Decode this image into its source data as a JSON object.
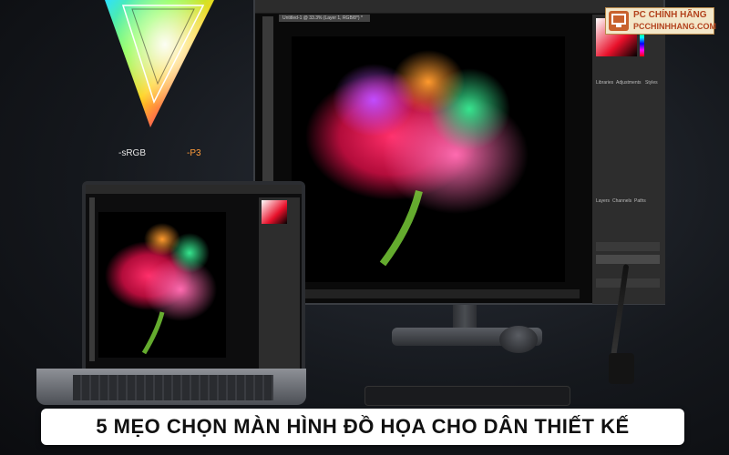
{
  "gamut": {
    "label_srgb": "-sRGB",
    "label_p3": "-P3"
  },
  "monitor": {
    "doc_tab": "Untitled-1 @ 33.3% (Layer 1, RGB/8*) *"
  },
  "panel": {
    "tabs": [
      "Libraries",
      "Adjustments",
      "Styles"
    ],
    "layers_tabs": [
      "Layers",
      "Channels",
      "Paths"
    ]
  },
  "logo": {
    "line1": "PC CHÍNH HÃNG",
    "line2": "PCCHINHHANG.COM"
  },
  "banner": {
    "title": "5 MẸO CHỌN MÀN HÌNH ĐỒ HỌA CHO DÂN THIẾT KẾ"
  },
  "colors": {
    "banner_bg": "#ffffff",
    "logo_accent": "#b3431e"
  }
}
